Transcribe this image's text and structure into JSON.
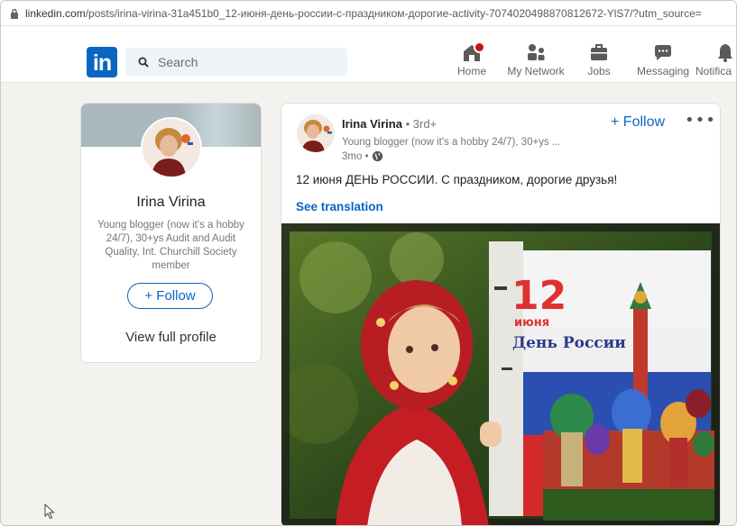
{
  "browser": {
    "url_domain": "linkedin.com",
    "url_path": "/posts/irina-virina-31a451b0_12-июня-день-россии-с-праздником-дорогие-activity-7074020498870812672-YlS7/?utm_source="
  },
  "header": {
    "logo_text": "in",
    "search_placeholder": "Search",
    "nav": [
      {
        "label": "Home",
        "icon": "home-icon"
      },
      {
        "label": "My Network",
        "icon": "people-icon"
      },
      {
        "label": "Jobs",
        "icon": "briefcase-icon"
      },
      {
        "label": "Messaging",
        "icon": "chat-icon"
      },
      {
        "label": "Notifica",
        "icon": "bell-icon"
      }
    ]
  },
  "profile_card": {
    "name": "Irina Virina",
    "headline": "Young blogger (now it's a hobby 24/7), 30+ys Audit and Audit Quality, Int. Churchill Society member",
    "follow_label": "+ Follow",
    "view_profile_label": "View full profile"
  },
  "post": {
    "author_name": "Irina Virina",
    "author_degree": "• 3rd+",
    "author_headline": "Young blogger (now it's a hobby 24/7), 30+ys ...",
    "time": "3mo •",
    "follow_label": "+ Follow",
    "more_label": "•••",
    "text": "12 июня ДЕНЬ РОССИИ. С праздником, дорогие друзья!",
    "translate_label": "See translation",
    "image": {
      "big_number": "12",
      "month": "июня",
      "caption": "День России"
    }
  },
  "colors": {
    "linkedin_blue": "#0a66c2",
    "page_bg": "#f3f2ef",
    "notification_red": "#cc1016"
  }
}
